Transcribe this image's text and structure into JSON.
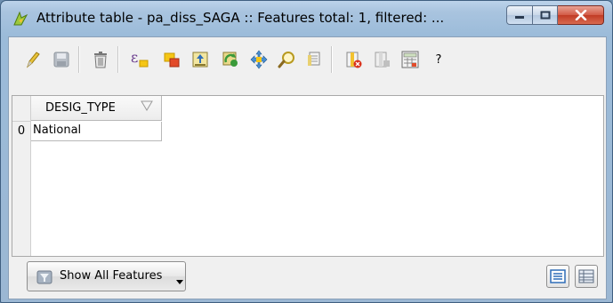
{
  "window": {
    "title": "Attribute table - pa_diss_SAGA :: Features total: 1, filtered: ..."
  },
  "toolbar": {
    "buttons": [
      {
        "name": "toggle-editing",
        "icon": "pencil-icon"
      },
      {
        "name": "save-edits",
        "icon": "save-icon"
      },
      {
        "name": "delete-selected",
        "icon": "trash-icon"
      },
      {
        "name": "select-by-expression",
        "icon": "expression-icon"
      },
      {
        "name": "deselect-all",
        "icon": "deselect-icon"
      },
      {
        "name": "move-selection-to-top",
        "icon": "move-top-icon"
      },
      {
        "name": "invert-selection",
        "icon": "invert-selection-icon"
      },
      {
        "name": "pan-map-to-selected",
        "icon": "pan-icon"
      },
      {
        "name": "zoom-map-to-selected",
        "icon": "zoom-icon"
      },
      {
        "name": "copy-selected-rows",
        "icon": "copy-icon"
      },
      {
        "name": "delete-column",
        "icon": "delete-column-icon"
      },
      {
        "name": "new-column",
        "icon": "new-column-icon"
      },
      {
        "name": "field-calculator",
        "icon": "calculator-icon"
      },
      {
        "name": "help",
        "icon": "help-icon"
      }
    ],
    "help_label": "?"
  },
  "table": {
    "columns": [
      "DESIG_TYPE"
    ],
    "rows": [
      {
        "index": "0",
        "values": [
          "National"
        ]
      }
    ]
  },
  "footer": {
    "filter_label": "Show All Features"
  },
  "colors": {
    "title_bar": "#a9c4df",
    "close_button": "#c13b24",
    "client_bg": "#f0f0f0"
  }
}
